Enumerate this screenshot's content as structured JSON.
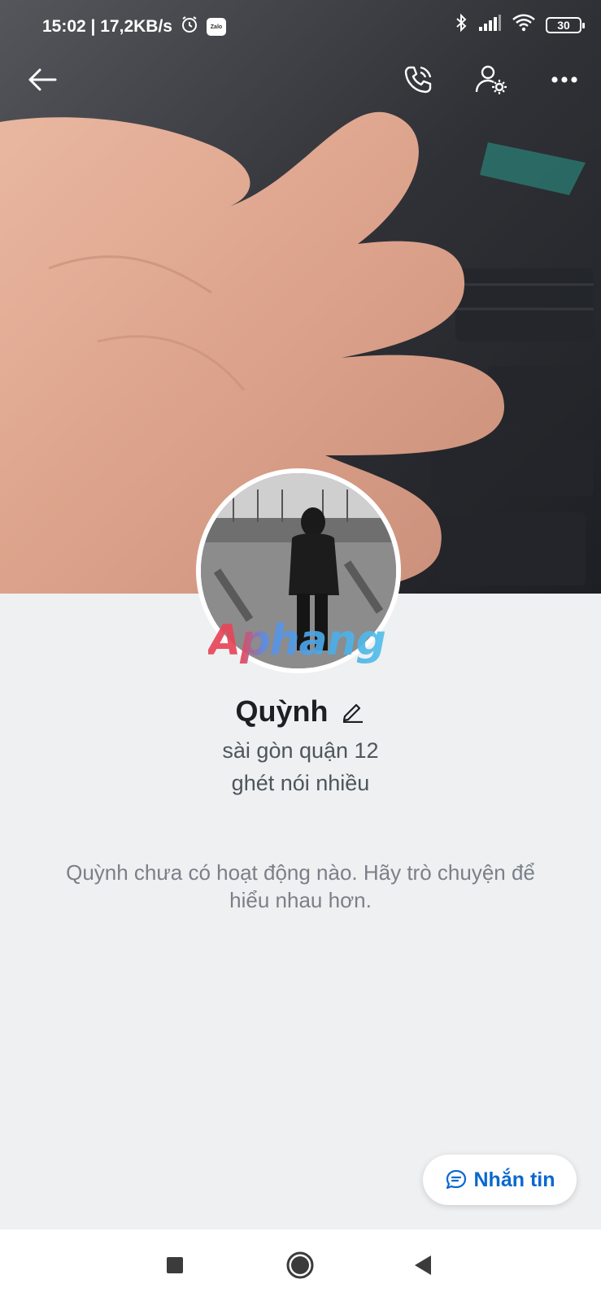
{
  "status_bar": {
    "time_speed": "15:02 | 17,2KB/s",
    "zalo_label": "Zalo",
    "battery": "30"
  },
  "top_bar": {
    "icons": [
      "back-arrow-icon",
      "phone-icon",
      "user-settings-icon",
      "more-icon"
    ]
  },
  "profile": {
    "name": "Quỳnh",
    "bio_line_1": "sài gòn quận 12",
    "bio_line_2": "ghét nói nhiều"
  },
  "watermark": "Aphang",
  "activity": {
    "empty_message": "Quỳnh chưa có hoạt động nào. Hãy trò chuyện để hiểu nhau hơn."
  },
  "message_button": {
    "label": "Nhắn tin"
  },
  "colors": {
    "background": "#eef0f2",
    "accent": "#0a68d0",
    "text_primary": "#1d1f22",
    "text_secondary": "#4e555c",
    "text_muted": "#7b8088"
  }
}
